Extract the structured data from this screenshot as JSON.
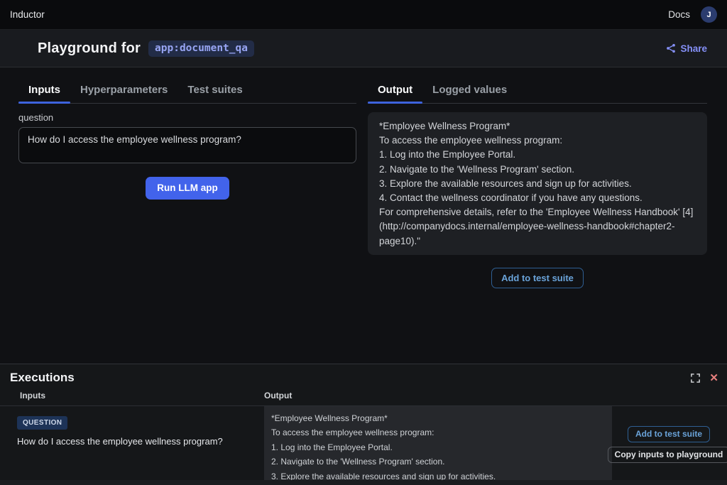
{
  "topbar": {
    "brand": "Inductor",
    "docs": "Docs",
    "avatar_initial": "J"
  },
  "header": {
    "title": "Playground for",
    "app_badge": "app:document_qa",
    "share": "Share"
  },
  "playground": {
    "input_tabs": [
      {
        "label": "Inputs"
      },
      {
        "label": "Hyperparameters"
      },
      {
        "label": "Test suites"
      }
    ],
    "question": {
      "label": "question",
      "value": "How do I access the employee wellness program?"
    },
    "run_button": "Run LLM app",
    "output_tabs": [
      {
        "label": "Output"
      },
      {
        "label": "Logged values"
      }
    ],
    "output_lines": [
      "*Employee Wellness Program*",
      "To access the employee wellness program:",
      "1. Log into the Employee Portal.",
      "2. Navigate to the 'Wellness Program' section.",
      "3. Explore the available resources and sign up for activities.",
      "4. Contact the wellness coordinator if you have any questions.",
      "For comprehensive details, refer to the 'Employee Wellness Handbook' [4]",
      "(http://companydocs.internal/employee-wellness-handbook#chapter2-page10).\""
    ],
    "add_to_test_suite": "Add to test suite"
  },
  "executions": {
    "title": "Executions",
    "columns": {
      "inputs": "Inputs",
      "output": "Output"
    },
    "row": {
      "badge": "QUESTION",
      "question": "How do I access the employee wellness program?",
      "output_lines": [
        "*Employee Wellness Program*",
        "To access the employee wellness program:",
        "1. Log into the Employee Portal.",
        "2. Navigate to the 'Wellness Program' section.",
        "3. Explore the available resources and sign up for activities."
      ],
      "add_to_test_suite": "Add to test suite",
      "copy_inputs": "Copy inputs to playground"
    }
  },
  "colors": {
    "accent_blue": "#4263eb",
    "tab_underline": "#3e63dd",
    "share_purple": "#8590f7",
    "app_badge_text": "#98a5f3",
    "app_badge_bg": "#222c47",
    "question_badge_bg": "#1d3357",
    "close_red": "#e8807f",
    "outline_button_blue": "#6aa3d9"
  }
}
